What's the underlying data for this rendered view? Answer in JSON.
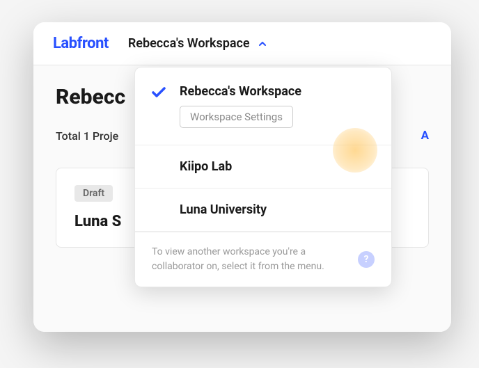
{
  "brand": "Labfront",
  "header": {
    "workspace_label": "Rebecca's Workspace"
  },
  "page": {
    "title_visible": "Rebecc",
    "project_count_visible": "Total 1 Proje",
    "add_link_visible": "A"
  },
  "card": {
    "badge": "Draft",
    "name_visible": "Luna S"
  },
  "dropdown": {
    "items": [
      {
        "label": "Rebecca's Workspace",
        "selected": true,
        "settings_label": "Workspace Settings"
      },
      {
        "label": "Kiipo Lab",
        "selected": false
      },
      {
        "label": "Luna University",
        "selected": false
      }
    ],
    "footer_text": "To view another workspace you're a collaborator on, select it from the menu.",
    "help_symbol": "?"
  },
  "colors": {
    "accent": "#2850ff",
    "highlight": "#ffc864"
  }
}
